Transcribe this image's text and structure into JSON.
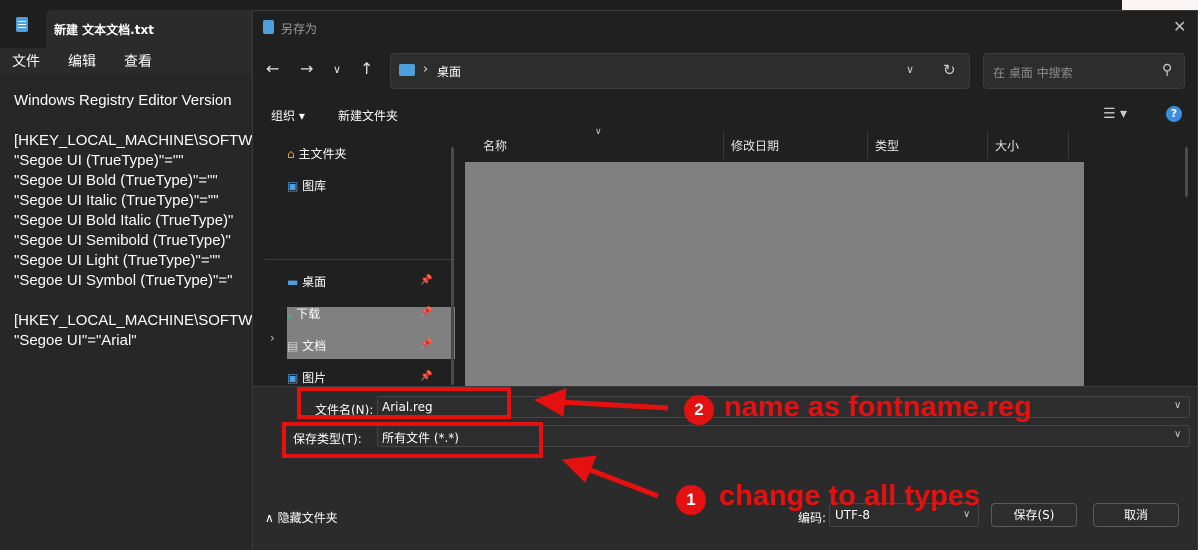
{
  "notepad": {
    "tab_title": "新建 文本文档.txt",
    "menu": [
      "文件",
      "编辑",
      "查看"
    ],
    "lines": [
      "Windows Registry Editor Version",
      "",
      "[HKEY_LOCAL_MACHINE\\SOFTW",
      "\"Segoe UI (TrueType)\"=\"\"",
      "\"Segoe UI Bold (TrueType)\"=\"\"",
      "\"Segoe UI Italic (TrueType)\"=\"\"",
      "\"Segoe UI Bold Italic (TrueType)\"",
      "\"Segoe UI Semibold (TrueType)\"",
      "\"Segoe UI Light (TrueType)\"=\"\"",
      "\"Segoe UI Symbol (TrueType)\"=\"",
      "",
      "[HKEY_LOCAL_MACHINE\\SOFTW",
      "\"Segoe UI\"=\"Arial\""
    ]
  },
  "dialog": {
    "title": "另存为",
    "address": {
      "location": "桌面"
    },
    "search_placeholder": "在 桌面 中搜索",
    "toolbar": {
      "organize": "组织 ▾",
      "new_folder": "新建文件夹"
    },
    "sidebar": {
      "items": [
        {
          "label": "主文件夹",
          "icon": "home-icon",
          "pinned": false
        },
        {
          "label": "图库",
          "icon": "gallery-icon",
          "pinned": false
        },
        {
          "label": "桌面",
          "icon": "desktop-icon",
          "pinned": true
        },
        {
          "label": "下载",
          "icon": "download-icon",
          "pinned": true
        },
        {
          "label": "文档",
          "icon": "document-icon",
          "pinned": true
        },
        {
          "label": "图片",
          "icon": "pictures-icon",
          "pinned": true
        }
      ]
    },
    "columns": [
      "名称",
      "修改日期",
      "类型",
      "大小"
    ],
    "filename_label": "文件名(N):",
    "filename_value": "Arial.reg",
    "filetype_label": "保存类型(T):",
    "filetype_value": "所有文件  (*.*)",
    "hide_folders": "隐藏文件夹",
    "encoding_label": "编码:",
    "encoding_value": "UTF-8",
    "save_button": "保存(S)",
    "cancel_button": "取消"
  },
  "annotations": {
    "step1_number": "1",
    "step1_text": "change to all types",
    "step2_number": "2",
    "step2_text": "name as fontname.reg",
    "color": "#e51010"
  }
}
